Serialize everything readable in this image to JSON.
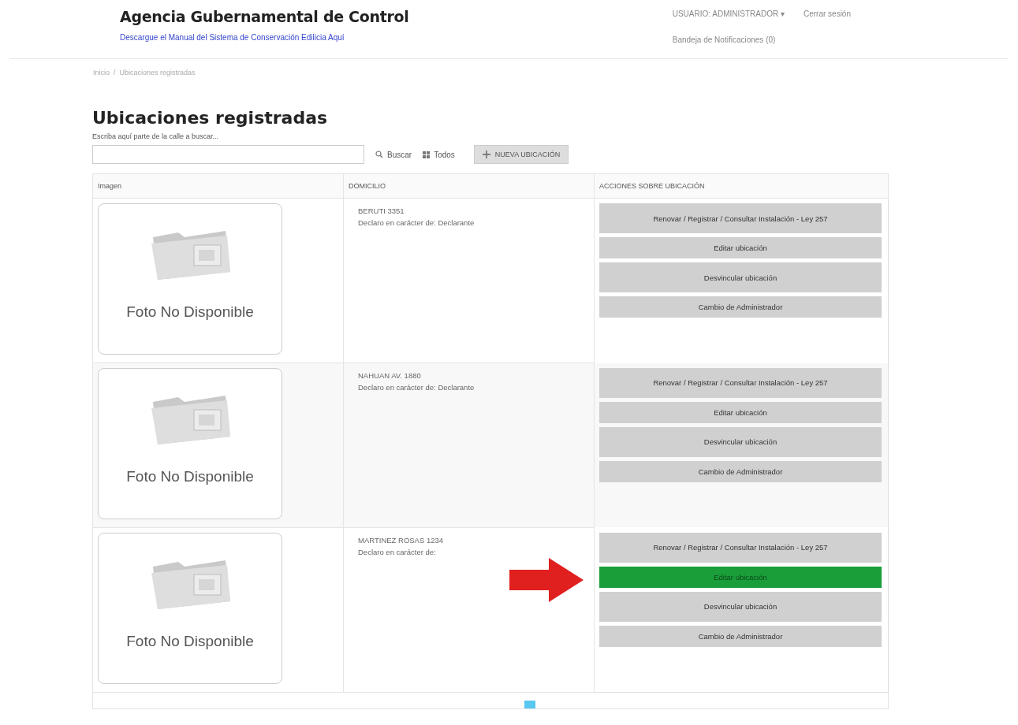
{
  "header": {
    "title": "Agencia Gubernamental de Control",
    "manual_link": "Descargue el Manual del Sistema de Conservación Edilicia Aquí",
    "user_menu": "USUARIO: ADMINISTRADOR ▾",
    "logout": "Cerrar sesión",
    "notifications": "Bandeja de Notificaciones (0)"
  },
  "breadcrumb": {
    "separator": "/",
    "items": [
      "Inicio",
      "Ubicaciones registradas"
    ]
  },
  "page_title": "Ubicaciones registradas",
  "search": {
    "label": "Escriba aquí parte de la calle a buscar...",
    "search_button": "Buscar",
    "all_button": "Todos",
    "new_button": "NUEVA UBICACIÓN"
  },
  "table": {
    "columns": [
      "Imagen",
      "DOMICILIO",
      "ACCIONES SOBRE UBICACIÓN"
    ],
    "rows": [
      {
        "image_caption": "Foto No Disponible",
        "address": "BERUTI 3351",
        "role": "Declaro en carácter de: Declarante",
        "actions": [
          {
            "label": "Renovar / Registrar / Consultar Instalación - Ley 257",
            "highlighted": false
          },
          {
            "label": "Editar ubicación",
            "highlighted": false
          },
          {
            "label": "Desvincular ubicación",
            "highlighted": false
          },
          {
            "label": "Cambio de Administrador",
            "highlighted": false
          }
        ],
        "arrow": false
      },
      {
        "image_caption": "Foto No Disponible",
        "address": "NAHUAN AV. 1880",
        "role": "Declaro en carácter de: Declarante",
        "actions": [
          {
            "label": "Renovar / Registrar / Consultar Instalación - Ley 257",
            "highlighted": false
          },
          {
            "label": "Editar ubicación",
            "highlighted": false
          },
          {
            "label": "Desvincular ubicación",
            "highlighted": false
          },
          {
            "label": "Cambio de Administrador",
            "highlighted": false
          }
        ],
        "arrow": false
      },
      {
        "image_caption": "Foto No Disponible",
        "address": "MARTINEZ ROSAS 1234",
        "role": "Declaro en carácter de:",
        "actions": [
          {
            "label": "Renovar / Registrar / Consultar Instalación - Ley 257",
            "highlighted": false
          },
          {
            "label": "Editar ubicación",
            "highlighted": true
          },
          {
            "label": "Desvincular ubicación",
            "highlighted": false
          },
          {
            "label": "Cambio de Administrador",
            "highlighted": false
          }
        ],
        "arrow": true
      }
    ]
  }
}
